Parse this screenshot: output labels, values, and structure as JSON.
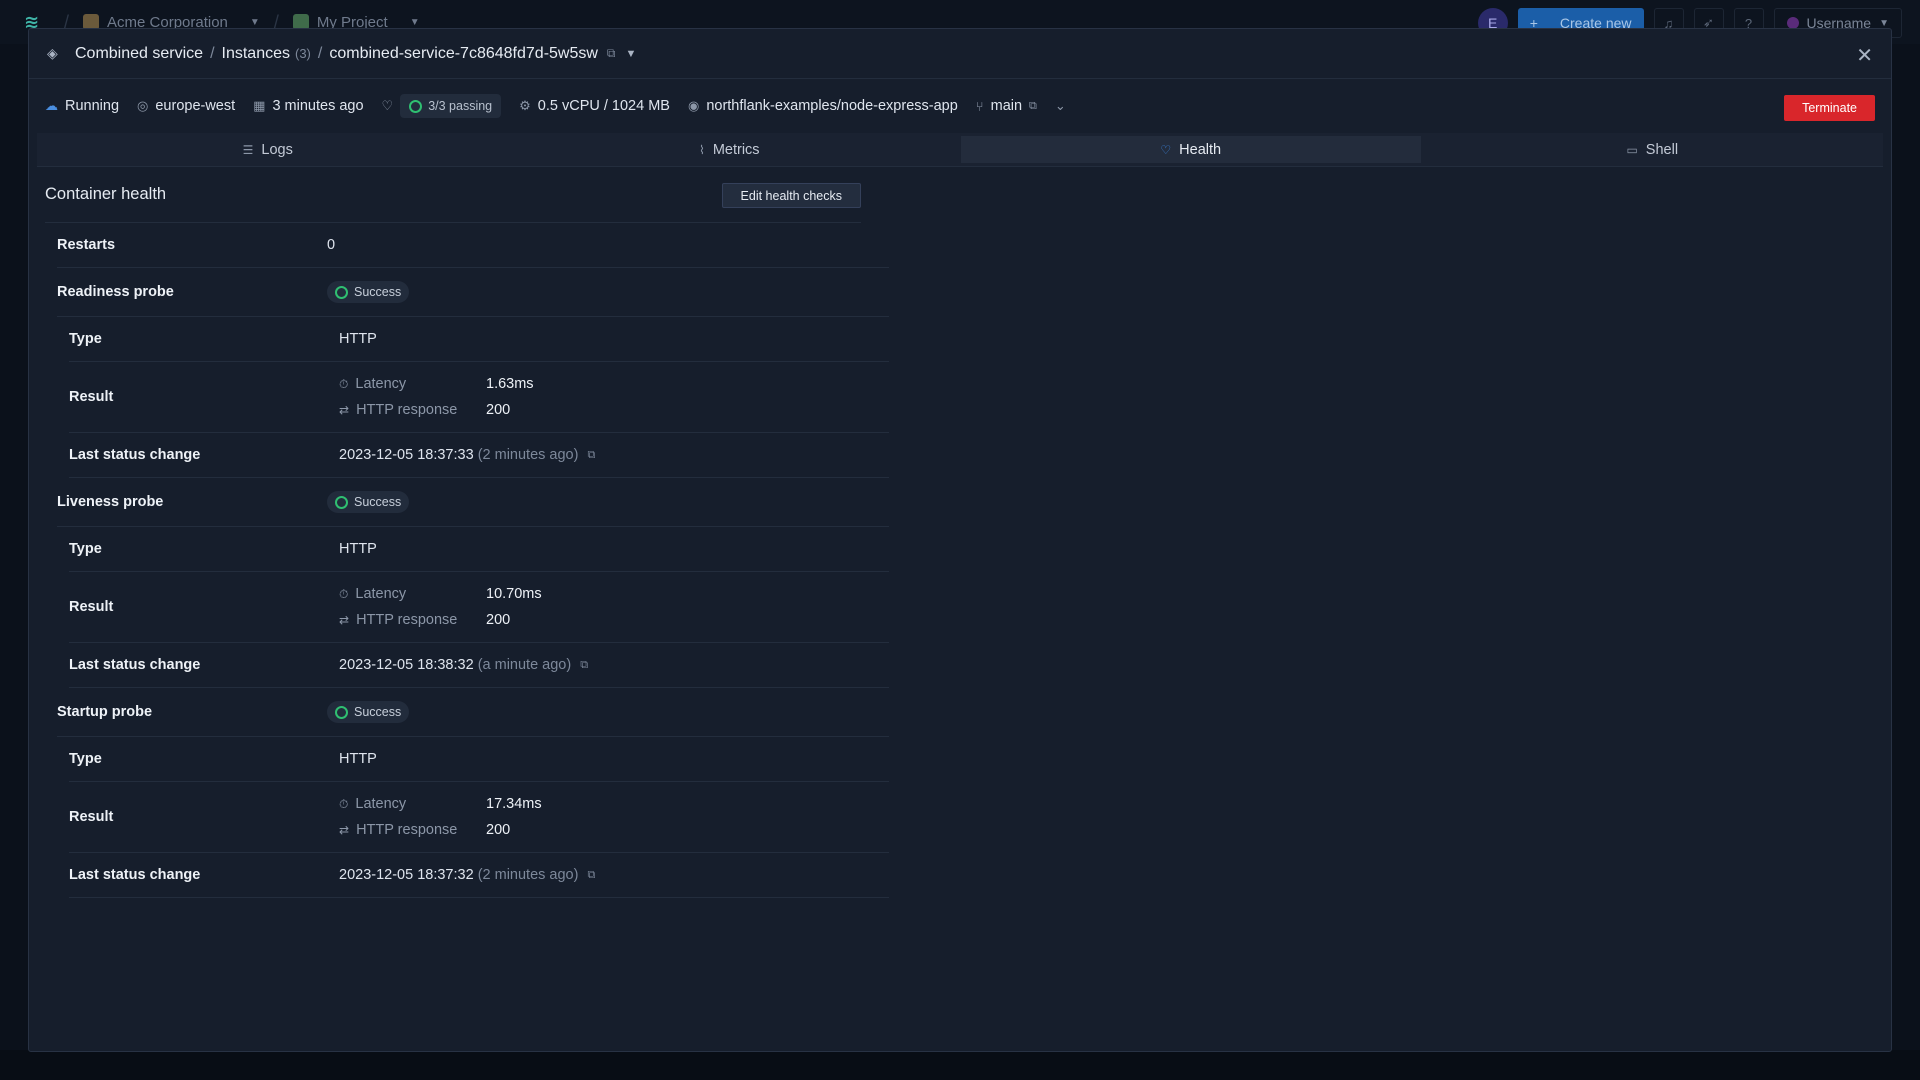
{
  "bg": {
    "org": "Acme Corporation",
    "project": "My Project",
    "avatar_letter": "E",
    "create_new": "Create new",
    "username": "Username"
  },
  "modal": {
    "breadcrumb": {
      "service": "Combined service",
      "instances": "Instances",
      "instances_count": "(3)",
      "instance": "combined-service-7c8648fd7d-5w5sw"
    },
    "status": {
      "state": "Running",
      "region": "europe-west",
      "age": "3 minutes ago",
      "checks": "3/3 passing",
      "resources": "0.5 vCPU / 1024 MB",
      "repo": "northflank-examples/node-express-app",
      "branch": "main"
    },
    "terminate_label": "Terminate",
    "tabs": [
      {
        "label": "Logs"
      },
      {
        "label": "Metrics"
      },
      {
        "label": "Health"
      },
      {
        "label": "Shell"
      }
    ],
    "active_tab": "Health"
  },
  "health": {
    "title": "Container health",
    "edit_label": "Edit health checks",
    "restarts_label": "Restarts",
    "restarts_value": "0",
    "labels": {
      "type": "Type",
      "result": "Result",
      "last_change": "Last status change",
      "latency": "Latency",
      "http_response": "HTTP response"
    },
    "probes": [
      {
        "name": "Readiness probe",
        "status": "Success",
        "type": "HTTP",
        "latency": "1.63ms",
        "http_response": "200",
        "last_change": "2023-12-05 18:37:33",
        "last_change_rel": "(2 minutes ago)"
      },
      {
        "name": "Liveness probe",
        "status": "Success",
        "type": "HTTP",
        "latency": "10.70ms",
        "http_response": "200",
        "last_change": "2023-12-05 18:38:32",
        "last_change_rel": "(a minute ago)"
      },
      {
        "name": "Startup probe",
        "status": "Success",
        "type": "HTTP",
        "latency": "17.34ms",
        "http_response": "200",
        "last_change": "2023-12-05 18:37:32",
        "last_change_rel": "(2 minutes ago)"
      }
    ]
  },
  "colors": {
    "accent": "#3d8ef0",
    "success": "#2fbf71",
    "danger": "#d9262b"
  }
}
